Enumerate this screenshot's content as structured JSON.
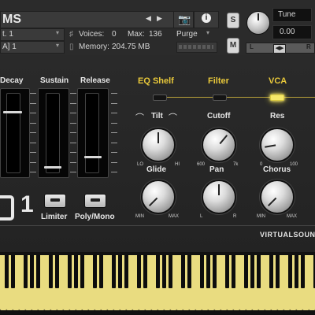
{
  "header": {
    "title": "MS",
    "output": "t. 1",
    "midi_channel": "A]  1",
    "voices_label": "Voices:",
    "voices_value": "0",
    "max_label": "Max:",
    "max_value": "136",
    "memory_label": "Memory:",
    "memory_value": "204.75 MB",
    "purge_label": "Purge",
    "solo_label": "S",
    "mute_label": "M",
    "tune_label": "Tune",
    "tune_value": "0.00",
    "pan_left": "L",
    "pan_right": "R",
    "info_label": "i"
  },
  "envelope": {
    "decay_label": "Decay",
    "sustain_label": "Sustain",
    "release_label": "Release",
    "decay_level": 0.77,
    "sustain_level": 0.07,
    "release_level": 0.2
  },
  "buttons": {
    "limiter_label": "Limiter",
    "polymono_label": "Poly/Mono"
  },
  "logo_text": "1",
  "signal_chain": {
    "eq_label": "EQ Shelf",
    "filter_label": "Filter",
    "vca_label": "VCA",
    "vca_active": true
  },
  "knobs": [
    {
      "label": "Tilt",
      "min": "LO",
      "max": "HI"
    },
    {
      "label": "Cutoff",
      "min": "600",
      "max": "7k"
    },
    {
      "label": "Res",
      "min": "0",
      "max": "100"
    },
    {
      "label": "Glide",
      "min": "MIN",
      "max": "MAX"
    },
    {
      "label": "Pan",
      "min": "L",
      "max": "R"
    },
    {
      "label": "Chorus",
      "min": "MIN",
      "max": "MAX"
    }
  ],
  "brand": "VIRTUALSOUNDI",
  "colors": {
    "accent": "#e8c83a",
    "led_on": "#f6e86a",
    "keys": "#e9dc80"
  }
}
